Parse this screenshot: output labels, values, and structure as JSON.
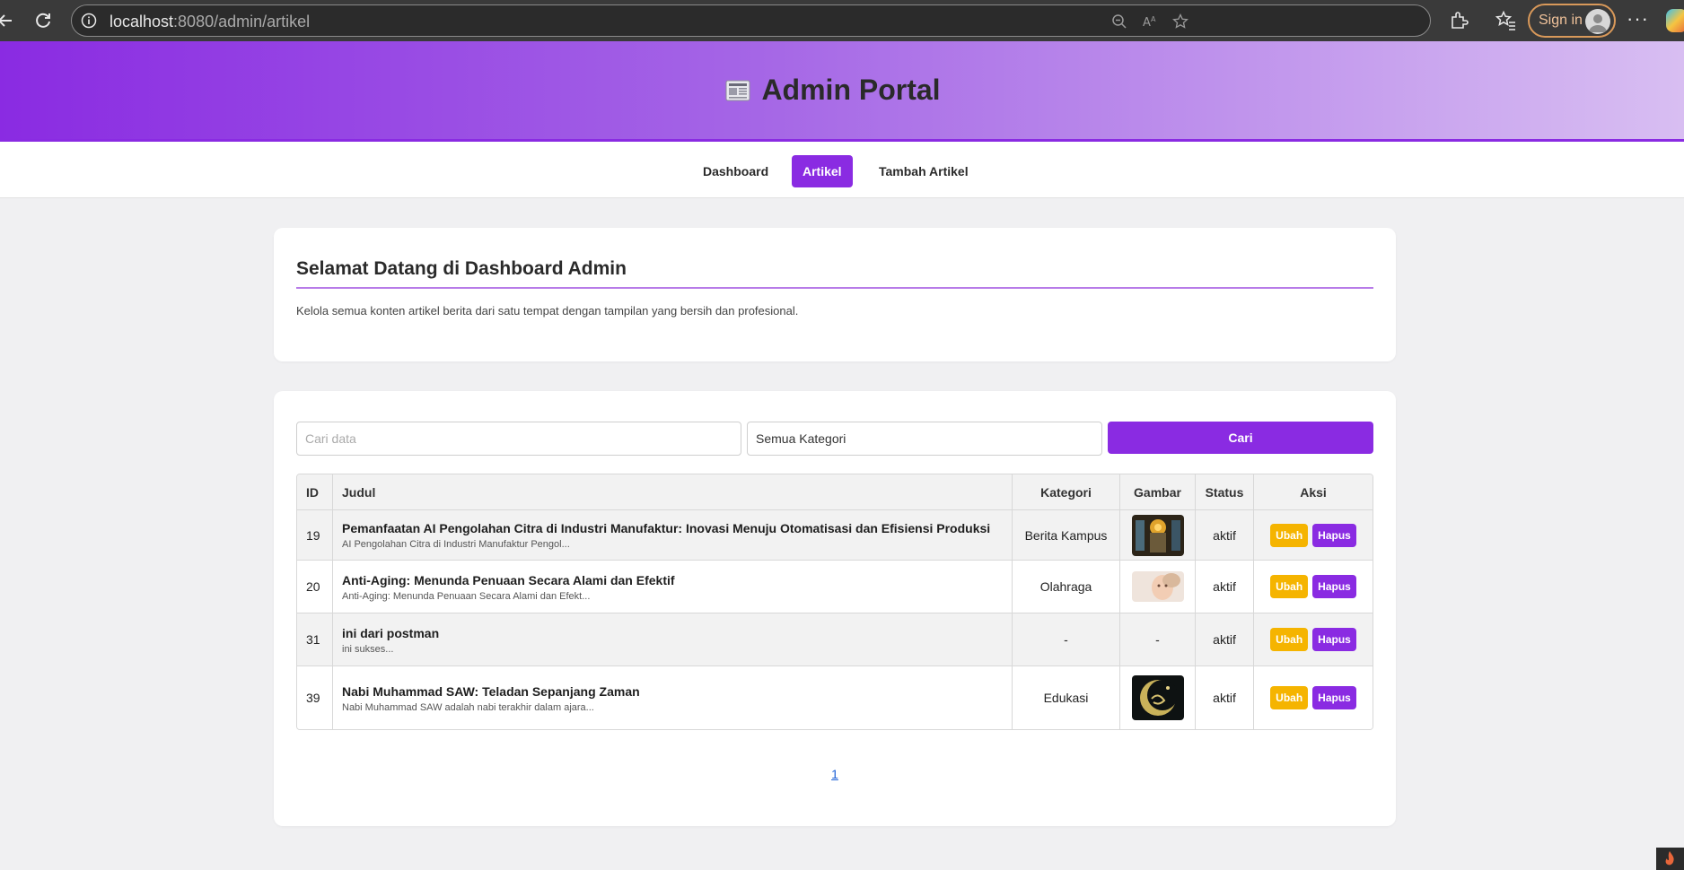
{
  "browser": {
    "url_host": "localhost",
    "url_path": ":8080/admin/artikel",
    "sign_in_label": "Sign in"
  },
  "header": {
    "title": "Admin Portal"
  },
  "nav": {
    "items": [
      {
        "label": "Dashboard"
      },
      {
        "label": "Artikel"
      },
      {
        "label": "Tambah Artikel"
      }
    ]
  },
  "welcome": {
    "title": "Selamat Datang di Dashboard Admin",
    "description": "Kelola semua konten artikel berita dari satu tempat dengan tampilan yang bersih dan profesional."
  },
  "filters": {
    "search_placeholder": "Cari data",
    "search_value": "",
    "category_selected": "Semua Kategori",
    "search_button": "Cari"
  },
  "table": {
    "headers": {
      "id": "ID",
      "title": "Judul",
      "category": "Kategori",
      "image": "Gambar",
      "status": "Status",
      "actions": "Aksi"
    },
    "rows": [
      {
        "id": "19",
        "title": "Pemanfaatan AI Pengolahan Citra di Industri Manufaktur: Inovasi Menuju Otomatisasi dan Efisiensi Produksi",
        "excerpt": "AI Pengolahan Citra di Industri Manufaktur Pengol...",
        "category": "Berita Kampus",
        "image": "thumbnail-robotics",
        "image_text": "",
        "status": "aktif",
        "edit_label": "Ubah",
        "delete_label": "Hapus"
      },
      {
        "id": "20",
        "title": "Anti-Aging: Menunda Penuaan Secara Alami dan Efektif",
        "excerpt": "Anti-Aging: Menunda Penuaan Secara Alami dan Efekt...",
        "category": "Olahraga",
        "image": "thumbnail-face",
        "image_text": "",
        "status": "aktif",
        "edit_label": "Ubah",
        "delete_label": "Hapus"
      },
      {
        "id": "31",
        "title": "ini dari postman",
        "excerpt": "ini sukses...",
        "category": "-",
        "image": "none",
        "image_text": "-",
        "status": "aktif",
        "edit_label": "Ubah",
        "delete_label": "Hapus"
      },
      {
        "id": "39",
        "title": "Nabi Muhammad SAW: Teladan Sepanjang Zaman",
        "excerpt": "Nabi Muhammad SAW adalah nabi terakhir dalam ajara...",
        "category": "Edukasi",
        "image": "thumbnail-crescent",
        "image_text": "",
        "status": "aktif",
        "edit_label": "Ubah",
        "delete_label": "Hapus"
      }
    ]
  },
  "pagination": {
    "current": "1"
  },
  "colors": {
    "primary": "#8a2be2",
    "warning": "#f5b400",
    "background": "#f0f0f2"
  }
}
